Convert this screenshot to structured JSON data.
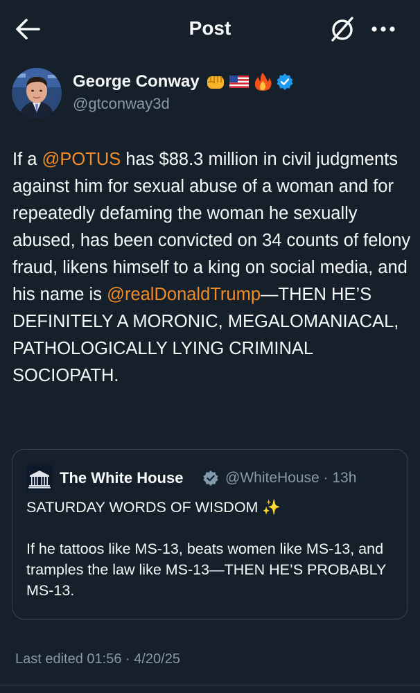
{
  "header": {
    "title": "Post",
    "back_icon": "arrow-left-icon",
    "grok_icon": "grok-icon",
    "more_icon": "more-horizontal-icon"
  },
  "author": {
    "name": "George Conway",
    "name_emojis": [
      "fist-icon",
      "us-flag-icon",
      "fire-icon"
    ],
    "verified": true,
    "handle": "@gtconway3d"
  },
  "post": {
    "segments": [
      {
        "text": "If a ",
        "type": "text"
      },
      {
        "text": "@POTUS",
        "type": "mention"
      },
      {
        "text": " has $88.3 million in civil judgments against him for sexual abuse of a woman and for repeatedly defaming the woman he sexually abused, has been convicted on 34 counts of felony fraud, likens himself to a king on social media, and his name is ",
        "type": "text"
      },
      {
        "text": "@realDonaldTrump",
        "type": "mention"
      },
      {
        "text": "—THEN HE’S DEFINITELY A MORONIC, MEGALOMANIACAL, PATHOLOGICALLY LYING CRIMINAL SOCIOPATH.",
        "type": "text"
      }
    ]
  },
  "quote": {
    "name": "The White House",
    "verified_color": "#829aab",
    "handle_time": "@WhiteHouse · 13h",
    "line1": "SATURDAY WORDS OF WISDOM ✨",
    "line2": "If he tattoos like MS-13, beats women like MS-13, and tramples the law like MS-13—THEN HE’S PROBABLY MS-13."
  },
  "footer": {
    "timestamp": "Last edited 01:56 · 4/20/25"
  },
  "colors": {
    "background": "#15202b",
    "text": "#f7f9f9",
    "secondary": "#8b98a5",
    "mention": "#f28c28",
    "verified": "#1d9bf0"
  }
}
